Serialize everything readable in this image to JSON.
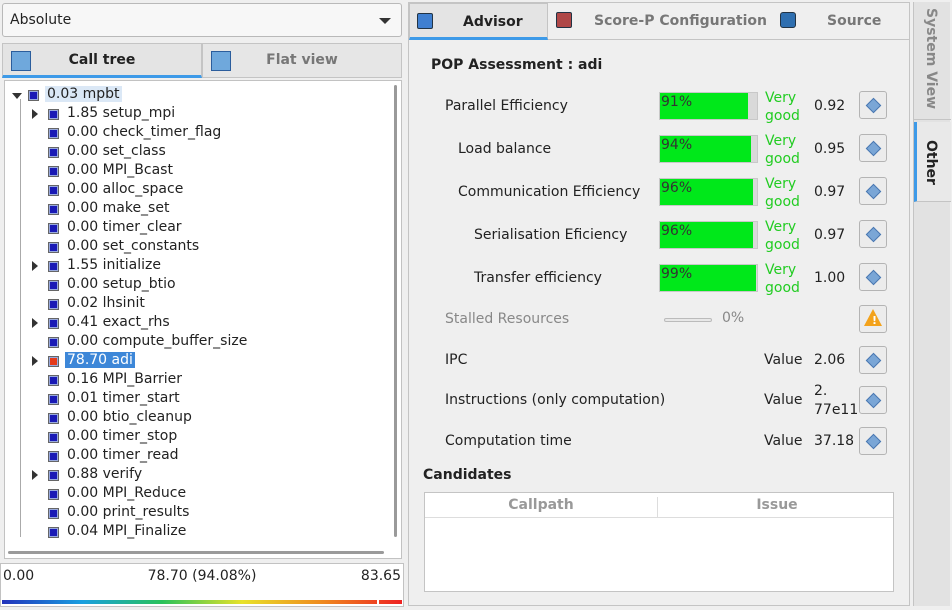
{
  "value_mode": "Absolute",
  "left_tabs": {
    "call_tree": "Call tree",
    "flat_view": "Flat view"
  },
  "tree": [
    {
      "label": "0.03 mpbt",
      "expander": "open",
      "state": "root"
    },
    {
      "label": "1.85 setup_mpi",
      "expander": "closed"
    },
    {
      "label": "0.00 check_timer_flag"
    },
    {
      "label": "0.00 set_class"
    },
    {
      "label": "0.00 MPI_Bcast"
    },
    {
      "label": "0.00 alloc_space"
    },
    {
      "label": "0.00 make_set"
    },
    {
      "label": "0.00 timer_clear"
    },
    {
      "label": "0.00 set_constants"
    },
    {
      "label": "1.55 initialize",
      "expander": "closed"
    },
    {
      "label": "0.00 setup_btio"
    },
    {
      "label": "0.02 lhsinit"
    },
    {
      "label": "0.41 exact_rhs",
      "expander": "closed"
    },
    {
      "label": "0.00 compute_buffer_size"
    },
    {
      "label": "78.70 adi",
      "expander": "closed",
      "state": "selected"
    },
    {
      "label": "0.16 MPI_Barrier"
    },
    {
      "label": "0.01 timer_start"
    },
    {
      "label": "0.00 btio_cleanup"
    },
    {
      "label": "0.00 timer_stop"
    },
    {
      "label": "0.00 timer_read"
    },
    {
      "label": "0.88 verify",
      "expander": "closed"
    },
    {
      "label": "0.00 MPI_Reduce"
    },
    {
      "label": "0.00 print_results"
    },
    {
      "label": "0.04 MPI_Finalize"
    }
  ],
  "scale": {
    "min": "0.00",
    "current": "78.70 (94.08%)",
    "max": "83.65",
    "marker_fraction": 0.9408
  },
  "right_tabs": {
    "advisor": "Advisor",
    "scorep": "Score-P Configuration",
    "source": "Source"
  },
  "assessment_title": "POP Assessment : adi",
  "metrics": [
    {
      "name": "Parallel Efficiency",
      "percent": "91%",
      "fraction": 0.91,
      "rating": [
        "Very",
        "good"
      ],
      "value": "0.92",
      "indent": 0
    },
    {
      "name": "Load balance",
      "percent": "94%",
      "fraction": 0.94,
      "rating": [
        "Very",
        "good"
      ],
      "value": "0.95",
      "indent": 1
    },
    {
      "name": "Communication Efficiency",
      "percent": "96%",
      "fraction": 0.96,
      "rating": [
        "Very",
        "good"
      ],
      "value": "0.97",
      "indent": 1
    },
    {
      "name": "Serialisation Eficiency",
      "percent": "96%",
      "fraction": 0.96,
      "rating": [
        "Very",
        "good"
      ],
      "value": "0.97",
      "indent": 2
    },
    {
      "name": "Transfer efficiency",
      "percent": "99%",
      "fraction": 0.99,
      "rating": [
        "Very",
        "good"
      ],
      "value": "1.00",
      "indent": 2
    }
  ],
  "stalled": {
    "name": "Stalled Resources",
    "percent": "0%"
  },
  "values": [
    {
      "name": "IPC",
      "label": "Value",
      "value": "2.06"
    },
    {
      "name": "Instructions (only computation)",
      "label": "Value",
      "value": [
        "2.",
        "77e11"
      ]
    },
    {
      "name": "Computation time",
      "label": "Value",
      "value": "37.18"
    }
  ],
  "candidates": {
    "title": "Candidates",
    "col_callpath": "Callpath",
    "col_issue": "Issue"
  },
  "side_tabs": {
    "system_view": "System View",
    "other": "Other"
  },
  "colors": {
    "accent": "#3d9ae8",
    "good": "#22cc22",
    "bar_fill": "#00e81a",
    "selection": "#3d87d8"
  }
}
